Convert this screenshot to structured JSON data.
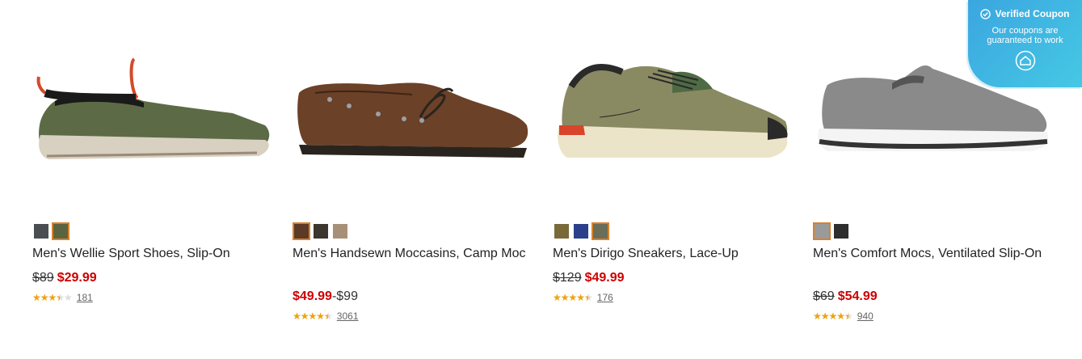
{
  "products": [
    {
      "name": "Men's Wellie Sport Shoes, Slip-On",
      "price_original": "$89",
      "price_sale": "$29.99",
      "rating": 3.5,
      "review_count": "181",
      "swatches": [
        {
          "color": "#4a4e52",
          "selected": false
        },
        {
          "color": "#5a6440",
          "selected": true
        }
      ]
    },
    {
      "name": "Men's Handsewn Moccasins, Camp Moc",
      "price_sale": "$49.99",
      "price_range_high": "-$99",
      "rating": 4.5,
      "review_count": "3061",
      "swatches": [
        {
          "color": "#5b3a26",
          "selected": true
        },
        {
          "color": "#3c3530",
          "selected": false
        },
        {
          "color": "#a89078",
          "selected": false
        }
      ]
    },
    {
      "name": "Men's Dirigo Sneakers, Lace-Up",
      "price_original": "$129",
      "price_sale": "$49.99",
      "rating": 4.5,
      "review_count": "176",
      "swatches": [
        {
          "color": "#7a6a3a",
          "selected": false
        },
        {
          "color": "#2c3f8a",
          "selected": false
        },
        {
          "color": "#6a6e58",
          "selected": true
        }
      ]
    },
    {
      "name": "Men's Comfort Mocs, Ventilated Slip-On",
      "price_original": "$69",
      "price_sale": "$54.99",
      "rating": 4.5,
      "review_count": "940",
      "swatches": [
        {
          "color": "#9a9a9a",
          "selected": true
        },
        {
          "color": "#2e2e2e",
          "selected": false
        }
      ]
    }
  ],
  "coupon": {
    "title": "Verified Coupon",
    "subtitle": "Our coupons are guaranteed to work"
  }
}
